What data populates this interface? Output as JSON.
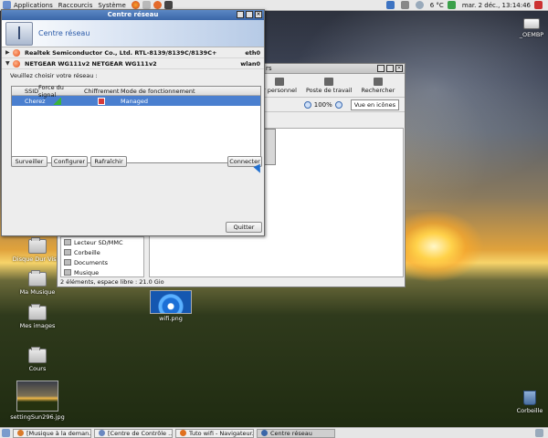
{
  "top_panel": {
    "menus": [
      "Applications",
      "Raccourcis",
      "Système"
    ],
    "weather": "6 °C",
    "clock": "mar. 2 déc., 13:14:46"
  },
  "desktop_icons": {
    "oembp": "_OEMBP",
    "corbeille": "Corbeille",
    "disque": "Disque Dur Vista",
    "musique": "Ma Musique",
    "images": "Mes images",
    "cours": "Cours",
    "setting": "settingSun296.jpg",
    "wifi": "wifi.png"
  },
  "file_manager": {
    "title": "rs",
    "toolbar": {
      "personnel": "r personnel",
      "poste": "Poste de travail",
      "rechercher": "Rechercher"
    },
    "zoom": "100%",
    "view_mode": "Vue en icônes",
    "sidebar": [
      "Lecteur SD/MMC",
      "Corbeille",
      "Documents",
      "Musique"
    ],
    "status": "2 éléments, espace libre : 21.0 Gio"
  },
  "network_center": {
    "title": "Centre réseau",
    "banner": "Centre réseau",
    "devices": [
      {
        "name": "Realtek Semiconductor Co., Ltd. RTL-8139/8139C/8139C+",
        "iface": "eth0",
        "expanded": false
      },
      {
        "name": "NETGEAR WG111v2 NETGEAR WG111v2",
        "iface": "wlan0",
        "expanded": true
      }
    ],
    "prompt": "Veuillez choisir votre réseau :",
    "columns": [
      "SSID",
      "Force du signal",
      "Chiffrement",
      "Mode de fonctionnement"
    ],
    "networks": [
      {
        "ssid": "Cherez",
        "mode": "Managed"
      }
    ],
    "buttons": {
      "surveiller": "Surveiller",
      "configurer": "Configurer",
      "rafraichir": "Rafraîchir",
      "connecter": "Connecter",
      "quitter": "Quitter"
    }
  },
  "taskbar": [
    {
      "label": "[Musique à la deman...",
      "active": false
    },
    {
      "label": "[Centre de Contrôle ...",
      "active": false
    },
    {
      "label": "Tuto wifi - Navigateur...",
      "active": false
    },
    {
      "label": "Centre réseau",
      "active": true
    }
  ],
  "colors": {
    "accent": "#3a66a8",
    "selection": "#4a7fcf"
  }
}
